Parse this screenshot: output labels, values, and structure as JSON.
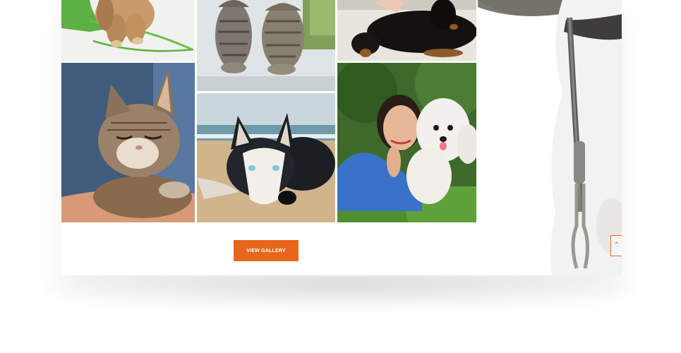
{
  "gallery": {
    "photos": [
      {
        "name": "puppy-in-green-bag"
      },
      {
        "name": "two-kittens-window"
      },
      {
        "name": "black-dog-lying"
      },
      {
        "name": "kitten-squinting"
      },
      {
        "name": "husky-on-beach"
      },
      {
        "name": "woman-with-white-poodle"
      }
    ],
    "view_gallery_label": "VIEW GALLERY"
  },
  "colors": {
    "accent": "#e8661c"
  },
  "icons": {
    "scroll_top": "chevron-up-icon"
  }
}
